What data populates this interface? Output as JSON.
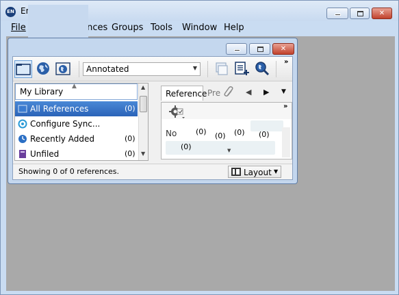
{
  "app": {
    "title": "En        X8",
    "logo_text": "EN"
  },
  "menu": {
    "file": "File",
    "references": "References",
    "groups": "Groups",
    "tools": "Tools",
    "window": "Window",
    "help": "Help"
  },
  "library_window": {
    "toolbar": {
      "style_select_value": "Annotated"
    },
    "groups": {
      "header": "My Library",
      "items": [
        {
          "label": "All References",
          "count": "(0)",
          "icon": "all-references-icon"
        },
        {
          "label": "Configure Sync...",
          "count": "",
          "icon": "sync-icon"
        },
        {
          "label": "Recently Added",
          "count": "(0)",
          "icon": "clock-icon"
        },
        {
          "label": "Unfiled",
          "count": "(0)",
          "icon": "unfiled-icon"
        }
      ]
    },
    "tabs": {
      "reference": "Reference",
      "preview": "Pre"
    },
    "reference_panel": {
      "notes_label": "No",
      "counts": [
        "(0)",
        "(0)",
        "(0)",
        "(0)",
        "(0)"
      ]
    },
    "status": {
      "text": "Showing 0 of 0 references.",
      "layout_label": "Layout"
    }
  },
  "colors": {
    "selection": "#2a63b8",
    "close_button": "#c1412c",
    "mdi_background": "#a9a9a9"
  }
}
